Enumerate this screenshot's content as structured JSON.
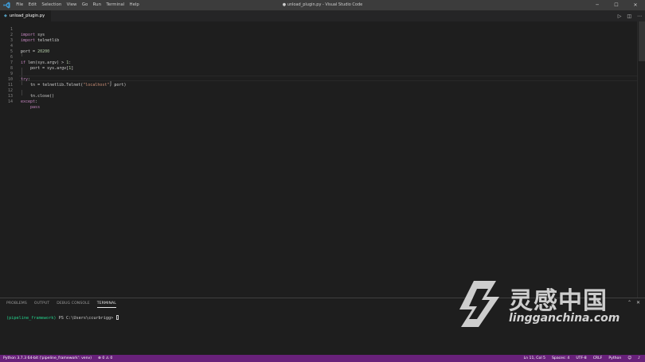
{
  "titlebar": {
    "menu": [
      "File",
      "Edit",
      "Selection",
      "View",
      "Go",
      "Run",
      "Terminal",
      "Help"
    ],
    "title": "● unload_plugin.py - Visual Studio Code",
    "controls": [
      "─",
      "☐",
      "✕"
    ]
  },
  "tab": {
    "label": "unload_plugin.py"
  },
  "editor": {
    "line_numbers": [
      "1",
      "2",
      "3",
      "4",
      "5",
      "6",
      "7",
      "8",
      "9",
      "10",
      "11",
      "12",
      "13",
      "14"
    ],
    "lines": {
      "l1_kw": "import",
      "l1_rest": " sys",
      "l2_kw": "import",
      "l2_rest": " telnetlib",
      "l4_a": "port = ",
      "l4_num": "20200",
      "l6_kw": "if",
      "l6_a": " len(sys.argv) > ",
      "l6_num": "1",
      "l6_b": ":",
      "l7_a": "    port = sys.argv[",
      "l7_num": "1",
      "l7_b": "]",
      "l9_kw": "try",
      "l9_b": ":",
      "l10_a": "    tn = telnetlib.Telnet(",
      "l10_str": "\"localhost\"",
      "l10_b": ", port)",
      "l12_a": "    tn.close()",
      "l13_kw": "except",
      "l13_b": ":",
      "l14_kw": "    pass"
    }
  },
  "panel": {
    "tabs": [
      "PROBLEMS",
      "OUTPUT",
      "DEBUG CONSOLE",
      "TERMINAL"
    ],
    "active_tab": "TERMINAL",
    "terminal_env": "(pipeline_framework)",
    "terminal_prompt": " PS C:\\Users\\ccurbrigg> "
  },
  "watermark": {
    "cn": "灵感中国",
    "url": "lingganchina.com"
  },
  "statusbar": {
    "python": "Python 3.7.3 64-bit ('pipeline_framework': venv)",
    "problems": "⊗ 0 ⚠ 0",
    "position": "Ln 11, Col 5",
    "spaces": "Spaces: 4",
    "encoding": "UTF-8",
    "eol": "CRLF",
    "language": "Python"
  },
  "colors": {
    "statusbar": "#68217a",
    "keyword": "#c586c0",
    "number": "#b5cea8",
    "string": "#ce9178"
  }
}
